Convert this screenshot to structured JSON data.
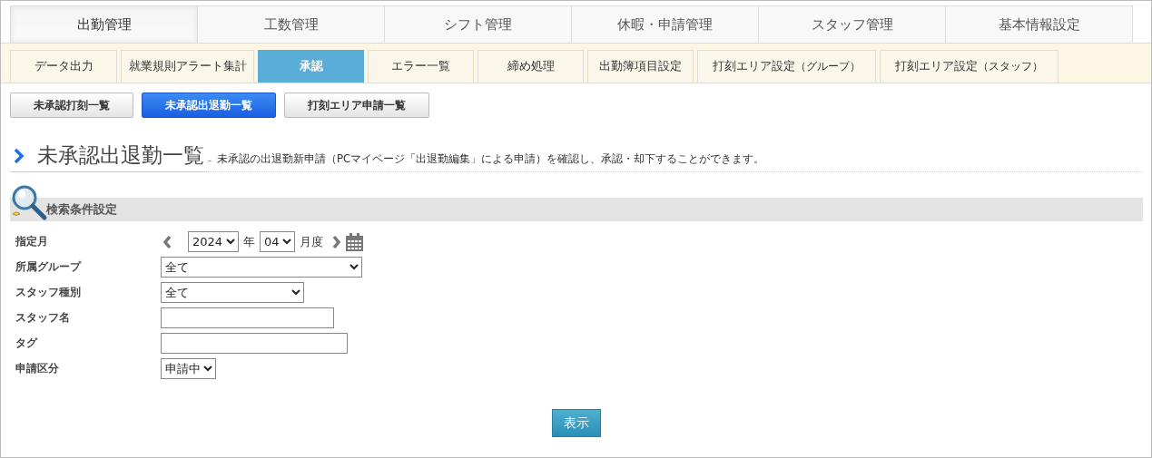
{
  "main_tabs": [
    {
      "label": "出勤管理",
      "selected": true
    },
    {
      "label": "工数管理",
      "selected": false
    },
    {
      "label": "シフト管理",
      "selected": false
    },
    {
      "label": "休暇・申請管理",
      "selected": false
    },
    {
      "label": "スタッフ管理",
      "selected": false
    },
    {
      "label": "基本情報設定",
      "selected": false
    }
  ],
  "sub_tabs": [
    {
      "label": "データ出力",
      "selected": false
    },
    {
      "label": "就業規則アラート集計",
      "selected": false
    },
    {
      "label": "承認",
      "selected": true
    },
    {
      "label": "エラー一覧",
      "selected": false
    },
    {
      "label": "締め処理",
      "selected": false
    },
    {
      "label": "出勤簿項目設定",
      "selected": false
    },
    {
      "label": "打刻エリア設定",
      "suffix": "（グループ）",
      "selected": false
    },
    {
      "label": "打刻エリア設定",
      "suffix": "（スタッフ）",
      "selected": false
    }
  ],
  "view_buttons": [
    {
      "label": "未承認打刻一覧",
      "selected": false
    },
    {
      "label": "未承認出退勤一覧",
      "selected": true
    },
    {
      "label": "打刻エリア申請一覧",
      "selected": false
    }
  ],
  "page_title": "未承認出退勤一覧",
  "title_separator": "-",
  "page_description": "未承認の出退勤新申請（PCマイページ「出退勤編集」による申請）を確認し、承認・却下することができます。",
  "search_section": {
    "title": "検索条件設定",
    "fields": [
      {
        "kind": "month",
        "label": "指定月",
        "year": "2024",
        "year_unit": "年",
        "month": "04",
        "month_unit": "月度"
      },
      {
        "kind": "select",
        "label": "所属グループ",
        "value": "全て"
      },
      {
        "kind": "select",
        "label": "スタッフ種別",
        "value": "全て"
      },
      {
        "kind": "text",
        "label": "スタッフ名"
      },
      {
        "kind": "text",
        "label": "タグ"
      },
      {
        "kind": "select",
        "label": "申請区分",
        "value": "申請中"
      }
    ],
    "submit": "表示"
  }
}
